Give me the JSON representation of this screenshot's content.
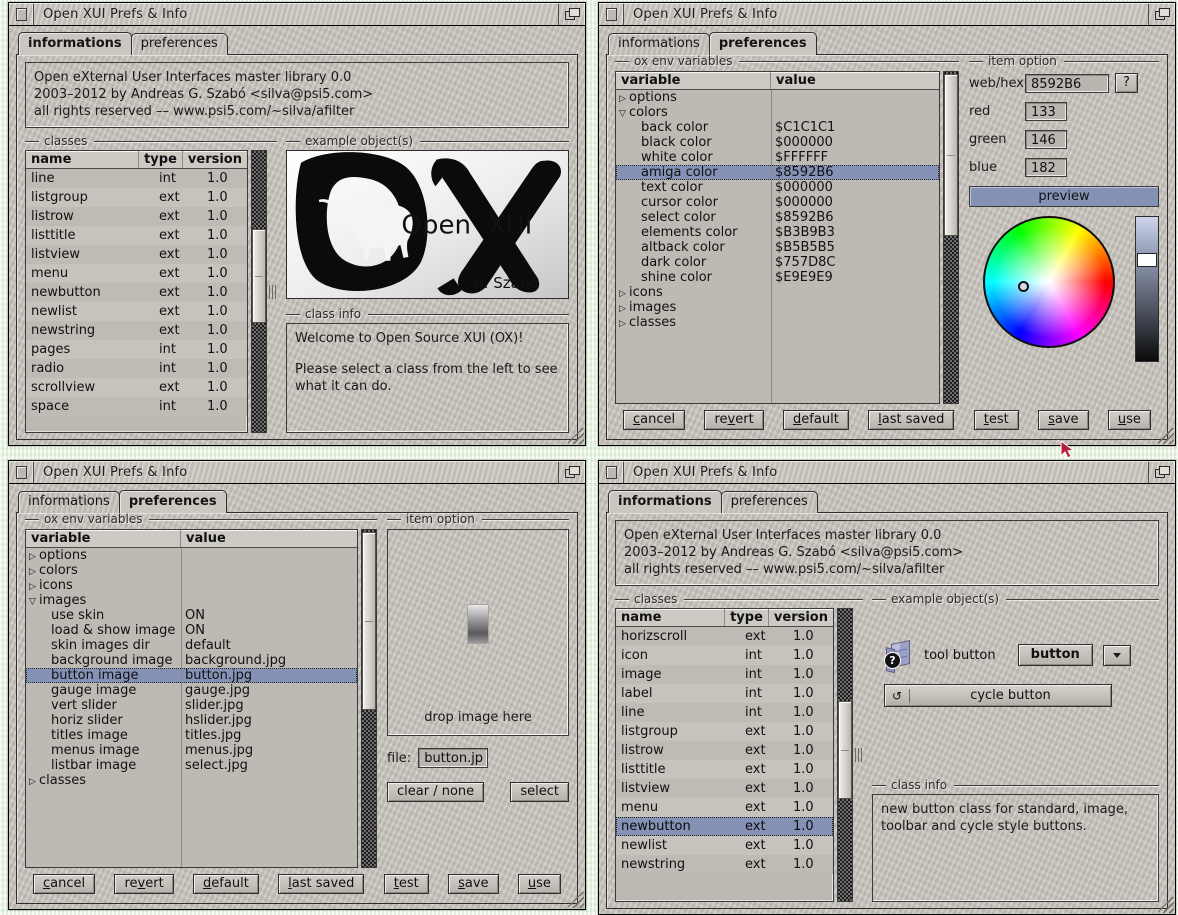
{
  "desktop": {
    "background_color": "#eaf4e2"
  },
  "window_title": "Open XUI Prefs & Info",
  "tabs": {
    "informations": "informations",
    "preferences": "preferences"
  },
  "about": {
    "line1": "Open eXternal User Interfaces master library 0.0",
    "line2": "2003–2012 by Andreas G. Szabó <silva@psi5.com>",
    "line3": "all rights reserved –– www.psi5.com/~silva/afilter"
  },
  "groups": {
    "classes": "classes",
    "example_objects": "example object(s)",
    "class_info": "class info",
    "ox_env_variables": "ox env variables",
    "item_option": "item option"
  },
  "class_table": {
    "headers": [
      "name",
      "type",
      "version"
    ],
    "rows_top_left": [
      [
        "line",
        "int",
        "1.0"
      ],
      [
        "listgroup",
        "ext",
        "1.0"
      ],
      [
        "listrow",
        "ext",
        "1.0"
      ],
      [
        "listtitle",
        "ext",
        "1.0"
      ],
      [
        "listview",
        "ext",
        "1.0"
      ],
      [
        "menu",
        "ext",
        "1.0"
      ],
      [
        "newbutton",
        "ext",
        "1.0"
      ],
      [
        "newlist",
        "ext",
        "1.0"
      ],
      [
        "newstring",
        "ext",
        "1.0"
      ],
      [
        "pages",
        "int",
        "1.0"
      ],
      [
        "radio",
        "int",
        "1.0"
      ],
      [
        "scrollview",
        "ext",
        "1.0"
      ],
      [
        "space",
        "int",
        "1.0"
      ]
    ],
    "rows_bottom_right": [
      [
        "horizscroll",
        "ext",
        "1.0"
      ],
      [
        "icon",
        "int",
        "1.0"
      ],
      [
        "image",
        "int",
        "1.0"
      ],
      [
        "label",
        "int",
        "1.0"
      ],
      [
        "line",
        "int",
        "1.0"
      ],
      [
        "listgroup",
        "ext",
        "1.0"
      ],
      [
        "listrow",
        "ext",
        "1.0"
      ],
      [
        "listtitle",
        "ext",
        "1.0"
      ],
      [
        "listview",
        "ext",
        "1.0"
      ],
      [
        "menu",
        "ext",
        "1.0"
      ],
      [
        "newbutton",
        "ext",
        "1.0"
      ],
      [
        "newlist",
        "ext",
        "1.0"
      ],
      [
        "newstring",
        "ext",
        "1.0"
      ]
    ],
    "selected_bottom_right": "newbutton"
  },
  "class_info": {
    "welcome_line1": "Welcome to Open Source XUI (OX)!",
    "welcome_line2": "Please select a class from the left to see",
    "welcome_line3": "what it can do.",
    "newbutton_line1": "new button class for standard, image,",
    "newbutton_line2": "toolbar and cycle style buttons."
  },
  "logo": {
    "word_open": "Open",
    "word_xui": "XUI",
    "signature": "A. Szabó"
  },
  "env_tree": {
    "headers": [
      "variable",
      "value"
    ],
    "colors_view": [
      {
        "label": "options",
        "value": "",
        "level": 0,
        "marker": "closed"
      },
      {
        "label": "colors",
        "value": "",
        "level": 0,
        "marker": "open"
      },
      {
        "label": "back color",
        "value": "$C1C1C1",
        "level": 1,
        "marker": "none"
      },
      {
        "label": "black color",
        "value": "$000000",
        "level": 1,
        "marker": "none"
      },
      {
        "label": "white color",
        "value": "$FFFFFF",
        "level": 1,
        "marker": "none"
      },
      {
        "label": "amiga color",
        "value": "$8592B6",
        "level": 1,
        "marker": "none",
        "selected": true
      },
      {
        "label": "text color",
        "value": "$000000",
        "level": 1,
        "marker": "none"
      },
      {
        "label": "cursor color",
        "value": "$000000",
        "level": 1,
        "marker": "none"
      },
      {
        "label": "select color",
        "value": "$8592B6",
        "level": 1,
        "marker": "none"
      },
      {
        "label": "elements color",
        "value": "$B3B9B3",
        "level": 1,
        "marker": "none"
      },
      {
        "label": "altback color",
        "value": "$B5B5B5",
        "level": 1,
        "marker": "none"
      },
      {
        "label": "dark color",
        "value": "$757D8C",
        "level": 1,
        "marker": "none"
      },
      {
        "label": "shine color",
        "value": "$E9E9E9",
        "level": 1,
        "marker": "none"
      },
      {
        "label": "icons",
        "value": "",
        "level": 0,
        "marker": "closed"
      },
      {
        "label": "images",
        "value": "",
        "level": 0,
        "marker": "closed"
      },
      {
        "label": "classes",
        "value": "",
        "level": 0,
        "marker": "closed"
      }
    ],
    "images_view": [
      {
        "label": "options",
        "value": "",
        "level": 0,
        "marker": "closed"
      },
      {
        "label": "colors",
        "value": "",
        "level": 0,
        "marker": "closed"
      },
      {
        "label": "icons",
        "value": "",
        "level": 0,
        "marker": "closed"
      },
      {
        "label": "images",
        "value": "",
        "level": 0,
        "marker": "open"
      },
      {
        "label": "use skin",
        "value": "ON",
        "level": 1,
        "marker": "none"
      },
      {
        "label": "load & show image",
        "value": "ON",
        "level": 1,
        "marker": "none"
      },
      {
        "label": "skin images dir",
        "value": "default",
        "level": 1,
        "marker": "none"
      },
      {
        "label": "background image",
        "value": "background.jpg",
        "level": 1,
        "marker": "none"
      },
      {
        "label": "button image",
        "value": "button.jpg",
        "level": 1,
        "marker": "none",
        "selected": true
      },
      {
        "label": "gauge image",
        "value": "gauge.jpg",
        "level": 1,
        "marker": "none"
      },
      {
        "label": "vert slider",
        "value": "slider.jpg",
        "level": 1,
        "marker": "none"
      },
      {
        "label": "horiz slider",
        "value": "hslider.jpg",
        "level": 1,
        "marker": "none"
      },
      {
        "label": "titles image",
        "value": "titles.jpg",
        "level": 1,
        "marker": "none"
      },
      {
        "label": "menus image",
        "value": "menus.jpg",
        "level": 1,
        "marker": "none"
      },
      {
        "label": "listbar image",
        "value": "select.jpg",
        "level": 1,
        "marker": "none"
      },
      {
        "label": "classes",
        "value": "",
        "level": 0,
        "marker": "closed"
      }
    ]
  },
  "color_option": {
    "webhex_label": "web/hex",
    "webhex_value": "8592B6",
    "help_label": "?",
    "red_label": "red",
    "red_value": "133",
    "green_label": "green",
    "green_value": "146",
    "blue_label": "blue",
    "blue_value": "182",
    "preview_label": "preview",
    "preview_color": "#8592B6"
  },
  "image_option": {
    "drop_hint": "drop image here",
    "file_label": "file:",
    "file_value": "button.jp",
    "clear_label": "clear / none",
    "select_label": "select"
  },
  "action_buttons": [
    {
      "label": "cancel",
      "accel": "c"
    },
    {
      "label": "revert",
      "accel": "v"
    },
    {
      "label": "default",
      "accel": "d"
    },
    {
      "label": "last saved",
      "accel": "l"
    },
    {
      "label": "test",
      "accel": "t"
    },
    {
      "label": "save",
      "accel": "s"
    },
    {
      "label": "use",
      "accel": "u"
    }
  ],
  "example_objects": {
    "tool_button_label": "tool button",
    "button_label": "button",
    "cycle_button_label": "cycle button"
  }
}
